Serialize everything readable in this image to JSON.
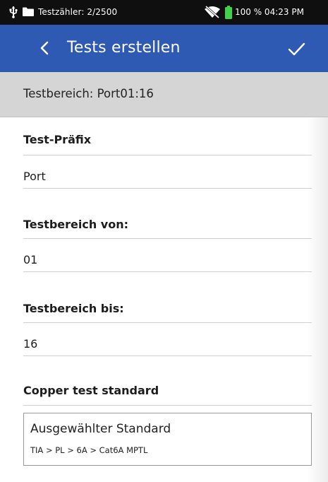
{
  "status_bar": {
    "counter": "Testzähler: 2/2500",
    "battery_time": "100 % 04:23 PM"
  },
  "app_bar": {
    "title": "Tests erstellen"
  },
  "range_header": "Testbereich: Port01:16",
  "form": {
    "prefix_label": "Test-Präfix",
    "prefix_value": "Port",
    "from_label": "Testbereich von:",
    "from_value": "01",
    "to_label": "Testbereich bis:",
    "to_value": "16",
    "standard_label": "Copper test standard",
    "standard_box_title": "Ausgewählter Standard",
    "standard_box_path": "TIA > PL > 6A > Cat6A MPTL"
  },
  "colors": {
    "app_bar": "#2f5ab3",
    "status_bar": "#0f0f0f",
    "header_band": "#d5d5d5",
    "battery": "#3ed14a"
  },
  "icons": [
    "usb-icon",
    "folder-icon",
    "wifi-off-icon",
    "battery-icon",
    "back-chevron-icon",
    "check-icon"
  ]
}
